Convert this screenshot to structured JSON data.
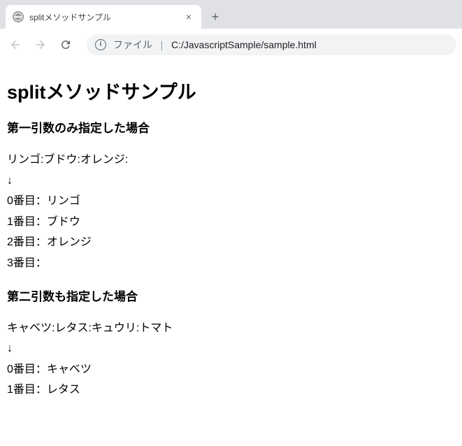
{
  "browser": {
    "tab_title": "splitメソッドサンプル",
    "address": {
      "scheme": "ファイル",
      "separator": "|",
      "path": "C:/JavascriptSample/sample.html"
    },
    "close_glyph": "×",
    "newtab_glyph": "+",
    "info_glyph": "i"
  },
  "page": {
    "h1": "splitメソッドサンプル",
    "section1": {
      "heading": "第一引数のみ指定した場合",
      "body": "リンゴ:ブドウ:オレンジ:\n↓\n0番目：リンゴ\n1番目：ブドウ\n2番目：オレンジ\n3番目："
    },
    "section2": {
      "heading": "第二引数も指定した場合",
      "body": "キャベツ:レタス:キュウリ:トマト\n↓\n0番目：キャベツ\n1番目：レタス"
    }
  }
}
